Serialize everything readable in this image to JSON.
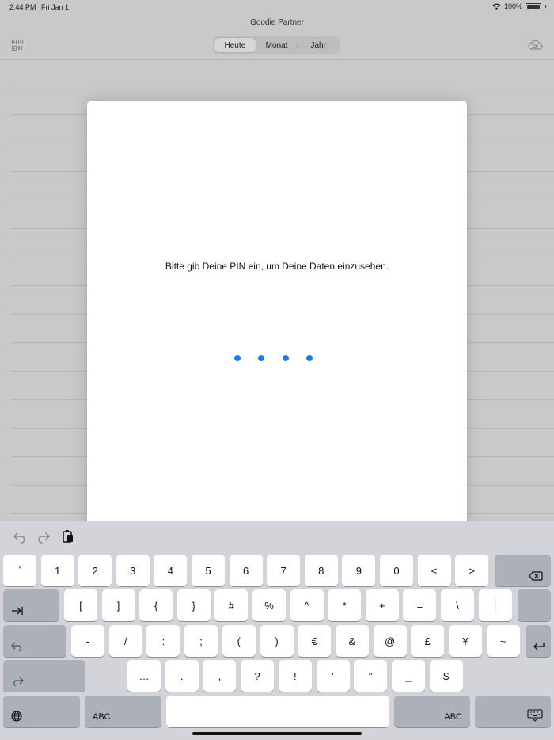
{
  "status": {
    "time": "2:44 PM",
    "date": "Fri Jan 1",
    "battery": "100%"
  },
  "app": {
    "title": "Goodie Partner"
  },
  "segments": [
    {
      "label": "Heute",
      "active": true
    },
    {
      "label": "Monat",
      "active": false
    },
    {
      "label": "Jahr",
      "active": false
    }
  ],
  "modal": {
    "prompt": "Bitte gib Deine PIN ein, um Deine Daten einzusehen.",
    "pin_length_entered": 4,
    "dot_color": "#1a7ee6"
  },
  "keyboard": {
    "row1": [
      "`",
      "1",
      "2",
      "3",
      "4",
      "5",
      "6",
      "7",
      "8",
      "9",
      "0",
      "<",
      ">"
    ],
    "row2": [
      "[",
      "]",
      "{",
      "}",
      "#",
      "%",
      "^",
      "*",
      "+",
      "=",
      "\\",
      "|"
    ],
    "row3": [
      "-",
      "/",
      ":",
      ";",
      "(",
      ")",
      "€",
      "&",
      "@",
      "£",
      "¥",
      "~"
    ],
    "row4": [
      "…",
      ".",
      ",",
      "?",
      "!",
      "′",
      "″",
      "_",
      "$"
    ],
    "abc_left": "ABC",
    "abc_right": "ABC"
  }
}
